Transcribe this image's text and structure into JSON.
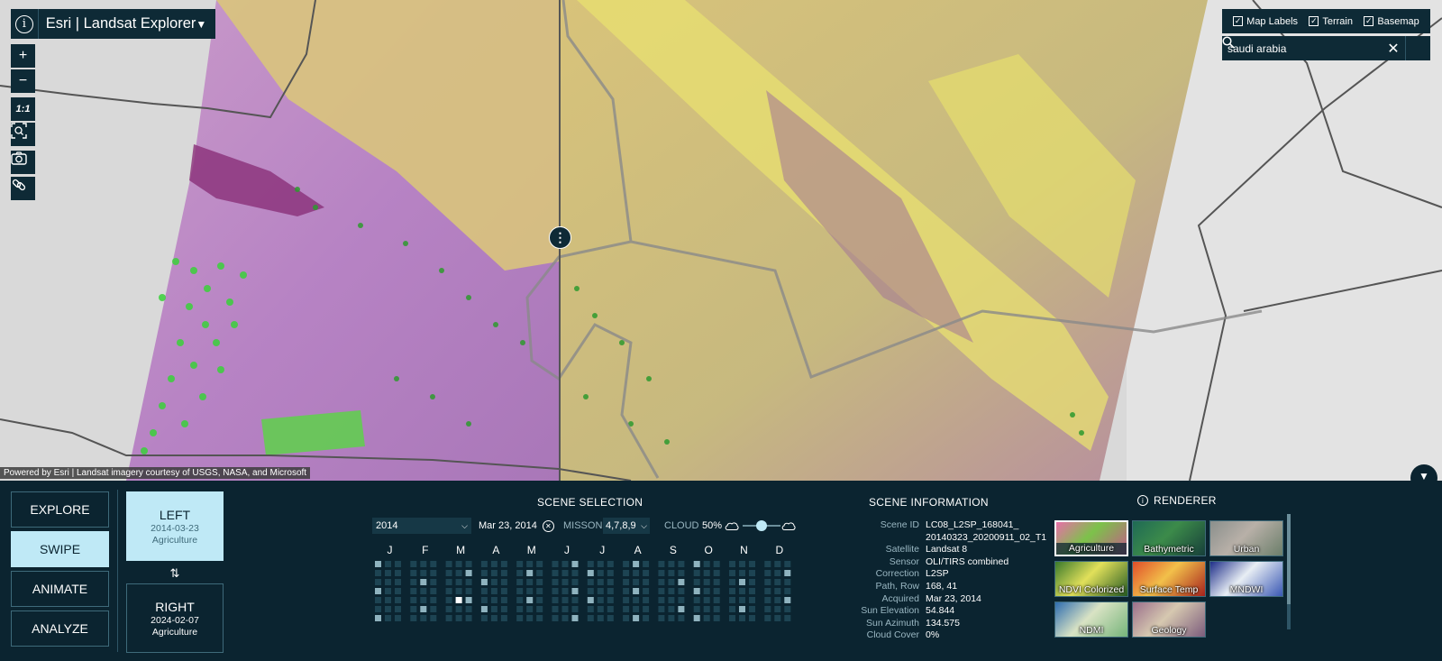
{
  "app": {
    "title": "Esri | Landsat Explorer"
  },
  "map_tools": {
    "zoom_in": "+",
    "zoom_out": "−",
    "scale": "1:1"
  },
  "layers": {
    "map_labels": "Map Labels",
    "terrain": "Terrain",
    "basemap": "Basemap",
    "map_labels_checked": true,
    "terrain_checked": true,
    "basemap_checked": true
  },
  "search": {
    "value": "saudi arabia"
  },
  "attribution": "Powered by Esri | Landsat imagery courtesy of USGS, NASA, and Microsoft",
  "modes": [
    "EXPLORE",
    "SWIPE",
    "ANIMATE",
    "ANALYZE"
  ],
  "active_mode": "SWIPE",
  "swipe": {
    "left": {
      "label": "LEFT",
      "date": "2014-03-23",
      "renderer": "Agriculture"
    },
    "right": {
      "label": "RIGHT",
      "date": "2024-02-07",
      "renderer": "Agriculture"
    },
    "swap": "⇅"
  },
  "scene_selection": {
    "title": "SCENE SELECTION",
    "year": "2014",
    "date": "Mar 23, 2014",
    "mission_label": "MISSON",
    "mission_value": "4,7,8,9",
    "cloud_label": "CLOUD",
    "cloud_value": "50%",
    "cloud_fraction": 0.5,
    "months": [
      "J",
      "F",
      "M",
      "A",
      "M",
      "J",
      "J",
      "A",
      "S",
      "O",
      "N",
      "D"
    ]
  },
  "scene_info": {
    "title": "SCENE INFORMATION",
    "rows": [
      {
        "k": "Scene ID",
        "v": "LC08_L2SP_168041_"
      },
      {
        "k": "",
        "v": "20140323_20200911_02_T1"
      },
      {
        "k": "Satellite",
        "v": "Landsat 8"
      },
      {
        "k": "Sensor",
        "v": "OLI/TIRS combined"
      },
      {
        "k": "Correction",
        "v": "L2SP"
      },
      {
        "k": "Path, Row",
        "v": "168, 41"
      },
      {
        "k": "Acquired",
        "v": "Mar 23, 2014"
      },
      {
        "k": "Sun Elevation",
        "v": "54.844"
      },
      {
        "k": "Sun Azimuth",
        "v": "134.575"
      },
      {
        "k": "Cloud Cover",
        "v": "0%"
      }
    ]
  },
  "renderer": {
    "title": "RENDERER",
    "items": [
      {
        "label": "Agriculture",
        "active": true,
        "colors": [
          "#e86fa9",
          "#7cc24a",
          "#c45a8a"
        ]
      },
      {
        "label": "Bathymetric",
        "active": false,
        "colors": [
          "#1f6a55",
          "#3c8b4a",
          "#173f3a"
        ]
      },
      {
        "label": "Urban",
        "active": false,
        "colors": [
          "#8a8f8c",
          "#b8b0a8",
          "#6b7e6a"
        ]
      },
      {
        "label": "NDVI Colorized",
        "active": false,
        "colors": [
          "#3a7a2c",
          "#e1e05a",
          "#255a22"
        ]
      },
      {
        "label": "Surface Temp",
        "active": false,
        "colors": [
          "#e04e2a",
          "#f2c04a",
          "#a6221d"
        ]
      },
      {
        "label": "MNDWI",
        "active": false,
        "colors": [
          "#1f2f8a",
          "#e8eef4",
          "#3a58b4"
        ]
      },
      {
        "label": "NDMI",
        "active": false,
        "colors": [
          "#2e6db0",
          "#d9e3c4",
          "#76b47a"
        ]
      },
      {
        "label": "Geology",
        "active": false,
        "colors": [
          "#9a6f8b",
          "#d6c8b0",
          "#7c5c7c"
        ]
      }
    ]
  }
}
